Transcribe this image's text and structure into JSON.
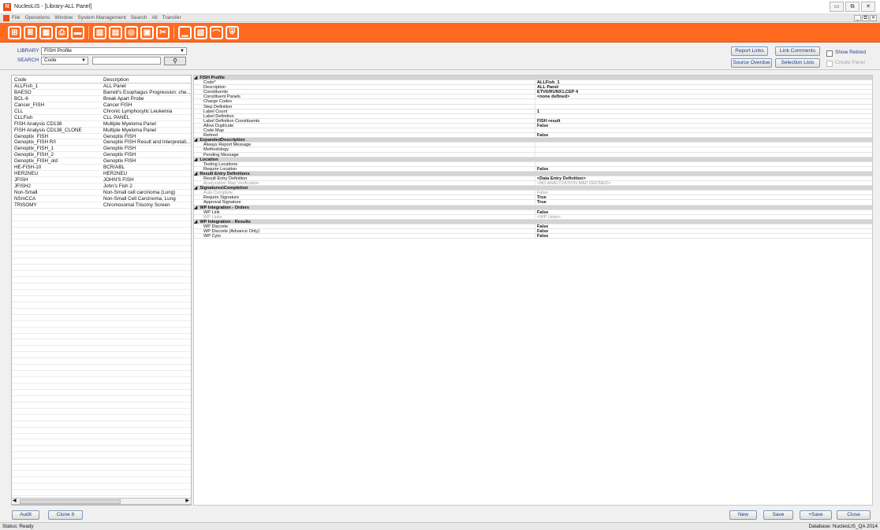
{
  "window": {
    "title": "NucleoLIS - [Library-ALL Panel]",
    "app_icon": "N"
  },
  "menu": [
    "File",
    "Operations",
    "Window",
    "System Management",
    "Search",
    "All",
    "Transfer"
  ],
  "toolbar_icons": [
    "orders-icon",
    "accession-icon",
    "grid-icon",
    "print-icon",
    "ink-icon",
    "barcode-icon",
    "document-icon",
    "badge-icon",
    "window-icon",
    "tools-icon",
    "chart-icon",
    "report-icon",
    "signature-icon",
    "shield-icon"
  ],
  "library": {
    "label": "LIBRARY",
    "value": "FISH Profile"
  },
  "search": {
    "label": "SEARCH",
    "field": "Code",
    "value": ""
  },
  "buttons": {
    "report_links": "Report Links",
    "link_comments": "Link Comments",
    "source_overdue": "Source Overdue",
    "selection_lists": "Selection Lists",
    "audit": "Audit",
    "clone_it": "Clone It",
    "new": "New",
    "save": "Save",
    "plus_save": "+Save",
    "close": "Close"
  },
  "checks": {
    "show_retired": "Show Retired",
    "create_panel": "Create Panel"
  },
  "list": {
    "headers": [
      "Code",
      "Description"
    ],
    "rows": [
      [
        "ALLFish_1",
        "ALL Panel"
      ],
      [
        "BAESO",
        "Barrett's Esophagus Progression: che..."
      ],
      [
        "BCL-6",
        "Break Apart Probe"
      ],
      [
        "Cancer_FISH",
        "Cancer FISH"
      ],
      [
        "CLL",
        "Chronic Lymphocytic Leukemia"
      ],
      [
        "CLLFish",
        "CLL PANEL"
      ],
      [
        "FISH Analysis CD138",
        "Multiple Myeloma Panel"
      ],
      [
        "FISH Analysis CD138_CLONE",
        "Multiple Myeloma Panel"
      ],
      [
        "Genoptix_FISH",
        "Genoptix FISH"
      ],
      [
        "Genoptix_FISH R/I",
        "Genoptix FISH Result and Interpretati..."
      ],
      [
        "Genoptix_FISH_1",
        "Genoptix FISH"
      ],
      [
        "Genoptix_FISH_2",
        "Genoptix FISH"
      ],
      [
        "Genoptix_FISH_old",
        "Genoptix FISH"
      ],
      [
        "HE-FISH-10",
        "BCR/ABL"
      ],
      [
        "HER2NEU",
        "HER2NEU"
      ],
      [
        "JFISH",
        "JOHN'S FISH"
      ],
      [
        "JFISH2",
        "John's Fish 2"
      ],
      [
        "Non-Small",
        "Non-Small cell carcinoma (Lung)"
      ],
      [
        "NSmCCA",
        "Non-Small Cell Carcinoma, Lung"
      ],
      [
        "TRISOMY",
        "Chromosomal Trisomy Screen"
      ]
    ],
    "empty_rows": 47
  },
  "props": [
    {
      "cat": "FISH Profile",
      "rows": [
        [
          "Code*",
          "ALLFish_1",
          0
        ],
        [
          "Description",
          "ALL Panel",
          0
        ],
        [
          "Constituents",
          "ETV6/RUNX1,CEP 4",
          0
        ],
        [
          "Constituent Panels",
          "<none defined>",
          0
        ],
        [
          "Charge Codes",
          "",
          0
        ],
        [
          "Step Definition",
          "",
          0
        ],
        [
          "Label Count",
          "1",
          0
        ],
        [
          "Label Definition",
          "",
          0
        ],
        [
          "Label Definition Constituents",
          "FISH result",
          0
        ],
        [
          "Allow Duplicate",
          "False",
          0
        ],
        [
          "Code Map",
          "",
          0
        ],
        [
          "Retired",
          "False",
          0
        ]
      ]
    },
    {
      "cat": "ExpandedDescription",
      "rows": [
        [
          "Always Report Message",
          "",
          0
        ],
        [
          "Methodology",
          "",
          0
        ],
        [
          "Pending Message",
          "",
          0
        ]
      ]
    },
    {
      "cat": "Location",
      "rows": [
        [
          "Testing Locations",
          "",
          0
        ],
        [
          "Require Location",
          "False",
          0
        ]
      ]
    },
    {
      "cat": "Result Entry Definitions",
      "rows": [
        [
          "Result Entry Definition",
          "<Data Entry Definition>",
          0
        ],
        [
          "Analyzation Map Verification",
          "<NO ANALYZATION MAP DEFINED>",
          1
        ]
      ]
    },
    {
      "cat": "Signatures\\Completion",
      "rows": [
        [
          "Auto Complete",
          "False",
          1
        ],
        [
          "Require Signature",
          "True",
          0
        ],
        [
          "Approval Signature",
          "True",
          0
        ]
      ]
    },
    {
      "cat": "WP Integration - Orders",
      "rows": [
        [
          "WP Link",
          "False",
          0
        ],
        [
          "WP Links",
          "<WP Links>",
          1
        ]
      ]
    },
    {
      "cat": "WP Integration - Results",
      "rows": [
        [
          "WP Discrete",
          "False",
          0
        ],
        [
          "WP Discrete (Advance Only)",
          "False",
          0
        ],
        [
          "WP Cyto",
          "False",
          0
        ]
      ]
    }
  ],
  "status": {
    "left": "Status: Ready",
    "right": "Database: NucleoLIS_QA 2014"
  },
  "colors": {
    "toolbar": "#ff6a1f",
    "category_bg": "#d4d4d4"
  }
}
